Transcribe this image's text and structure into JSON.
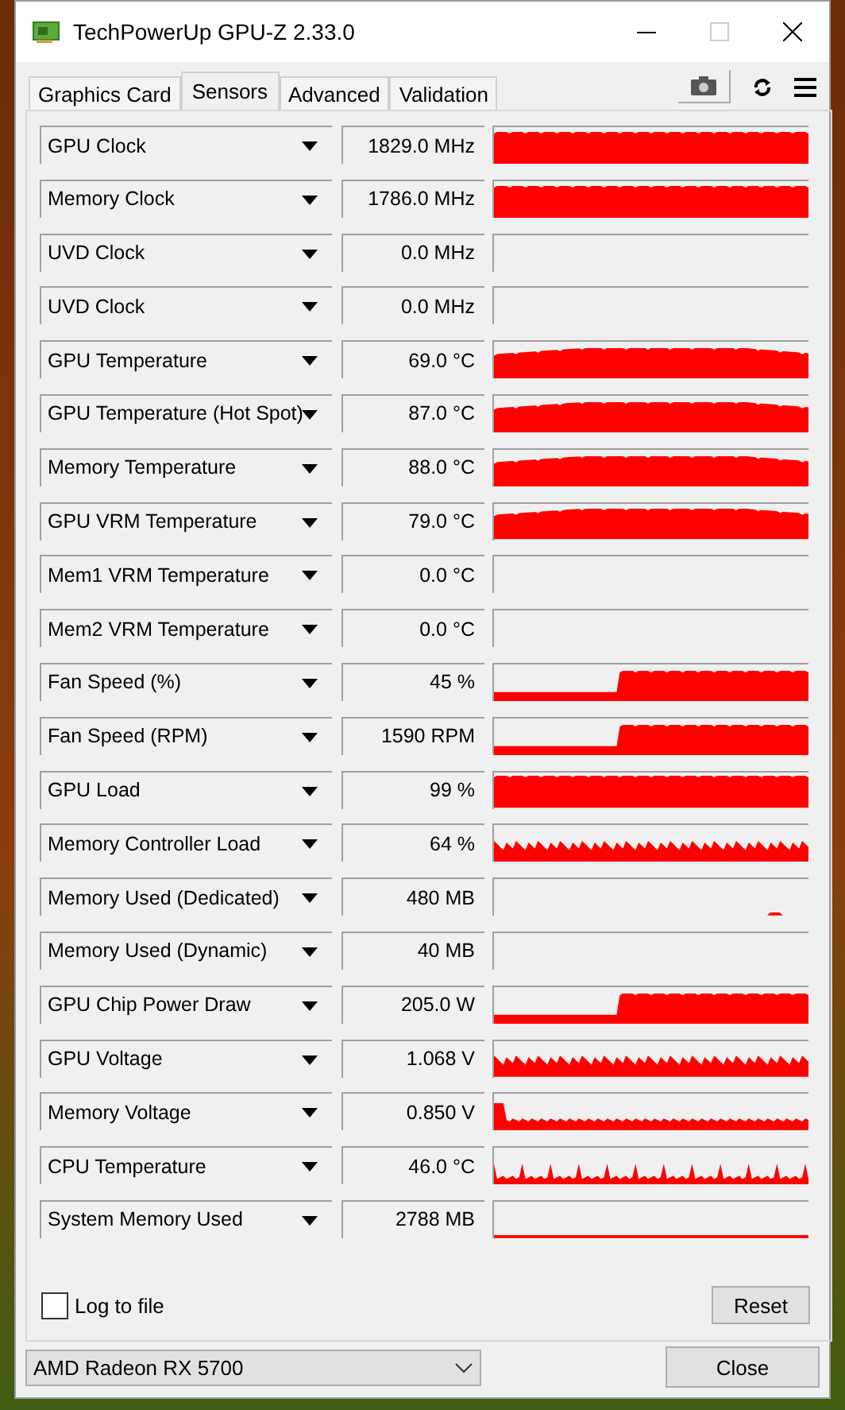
{
  "window": {
    "title": "TechPowerUp GPU-Z 2.33.0"
  },
  "tabs": [
    {
      "label": "Graphics Card",
      "selected": false
    },
    {
      "label": "Sensors",
      "selected": true
    },
    {
      "label": "Advanced",
      "selected": false
    },
    {
      "label": "Validation",
      "selected": false
    }
  ],
  "sensors": [
    {
      "name": "GPU Clock",
      "value": "1829.0 MHz",
      "kind": "full"
    },
    {
      "name": "Memory Clock",
      "value": "1786.0 MHz",
      "kind": "full"
    },
    {
      "name": "UVD Clock",
      "value": "0.0 MHz",
      "kind": "empty"
    },
    {
      "name": "UVD Clock",
      "value": "0.0 MHz",
      "kind": "empty"
    },
    {
      "name": "GPU Temperature",
      "value": "69.0 °C",
      "kind": "rise"
    },
    {
      "name": "GPU Temperature (Hot Spot)",
      "value": "87.0 °C",
      "kind": "rise"
    },
    {
      "name": "Memory Temperature",
      "value": "88.0 °C",
      "kind": "rise"
    },
    {
      "name": "GPU VRM Temperature",
      "value": "79.0 °C",
      "kind": "rise"
    },
    {
      "name": "Mem1 VRM Temperature",
      "value": "0.0 °C",
      "kind": "empty"
    },
    {
      "name": "Mem2 VRM Temperature",
      "value": "0.0 °C",
      "kind": "empty"
    },
    {
      "name": "Fan Speed (%)",
      "value": "45 %",
      "kind": "step"
    },
    {
      "name": "Fan Speed (RPM)",
      "value": "1590 RPM",
      "kind": "step"
    },
    {
      "name": "GPU Load",
      "value": "99 %",
      "kind": "full"
    },
    {
      "name": "Memory Controller Load",
      "value": "64 %",
      "kind": "noisy"
    },
    {
      "name": "Memory Used (Dedicated)",
      "value": "480 MB",
      "kind": "blip"
    },
    {
      "name": "Memory Used (Dynamic)",
      "value": "40 MB",
      "kind": "empty"
    },
    {
      "name": "GPU Chip Power Draw",
      "value": "205.0 W",
      "kind": "step"
    },
    {
      "name": "GPU Voltage",
      "value": "1.068 V",
      "kind": "noisy"
    },
    {
      "name": "Memory Voltage",
      "value": "0.850 V",
      "kind": "low"
    },
    {
      "name": "CPU Temperature",
      "value": "46.0 °C",
      "kind": "spiky"
    },
    {
      "name": "System Memory Used",
      "value": "2788 MB",
      "kind": "line"
    }
  ],
  "log_to_file": {
    "label": "Log to file",
    "checked": false
  },
  "reset_button": "Reset",
  "gpu_select": {
    "value": "AMD Radeon RX 5700"
  },
  "close_button": "Close"
}
